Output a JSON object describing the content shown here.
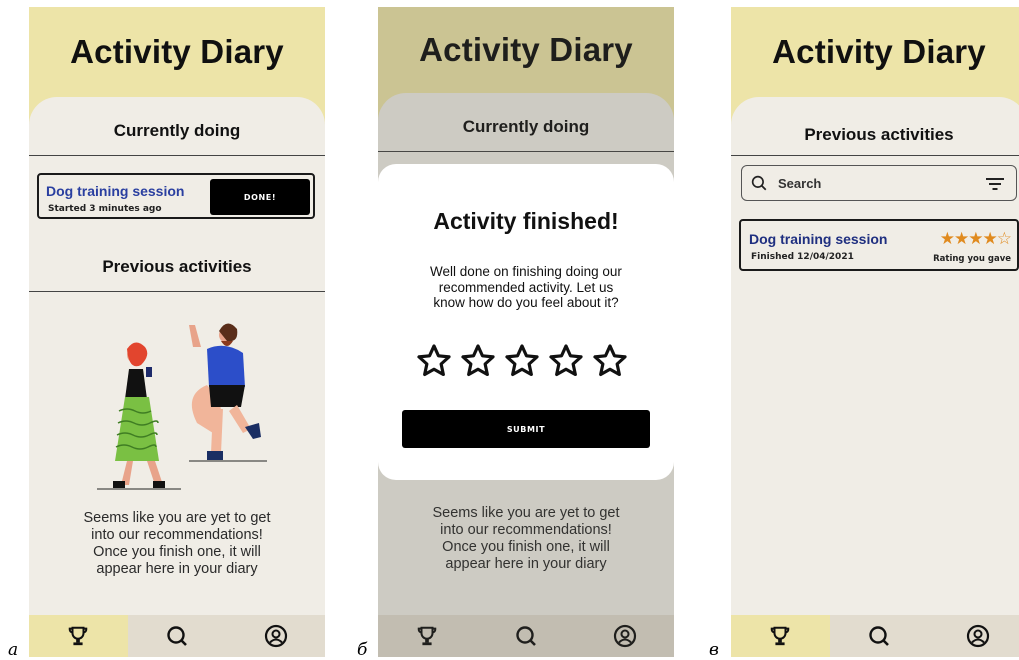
{
  "panels": {
    "a": {
      "letter": "а",
      "title": "Activity Diary",
      "currently_doing": "Currently doing",
      "activity_name": "Dog training session",
      "activity_started": "Started 3 minutes ago",
      "done_label": "DONE!",
      "previous_activities": "Previous activities",
      "empty_lines": [
        "Seems like you are yet to get",
        "into our recommendations!",
        "Once you finish one, it will",
        "appear here in your diary"
      ]
    },
    "b": {
      "letter": "б",
      "title": "Activity Diary",
      "currently_doing": "Currently doing",
      "empty_lines": [
        "Seems like you are yet to get",
        "into our recommendations!",
        "Once you finish one, it will",
        "appear here in your diary"
      ],
      "modal_title": "Activity finished!",
      "modal_lines": [
        "Well done on finishing doing our",
        "recommended activity. Let us",
        "know how do you feel about it?"
      ],
      "submit_label": "SUBMIT"
    },
    "c": {
      "letter": "в",
      "title": "Activity Diary",
      "previous_activities": "Previous activities",
      "search_placeholder": "Search",
      "activity_name": "Dog training session",
      "activity_finished": "Finished 12/04/2021",
      "rating_stars": "★★★★☆",
      "rating_label": "Rating you gave"
    }
  },
  "nav_icons": [
    "trophy-icon",
    "search-icon",
    "profile-icon"
  ],
  "colors": {
    "header": "#ede4a8",
    "background": "#f0ede6",
    "nav": "#e2dccf",
    "activity_title": "#2a3fa0",
    "star_rating": "#e08a1e",
    "button": "#000000"
  }
}
